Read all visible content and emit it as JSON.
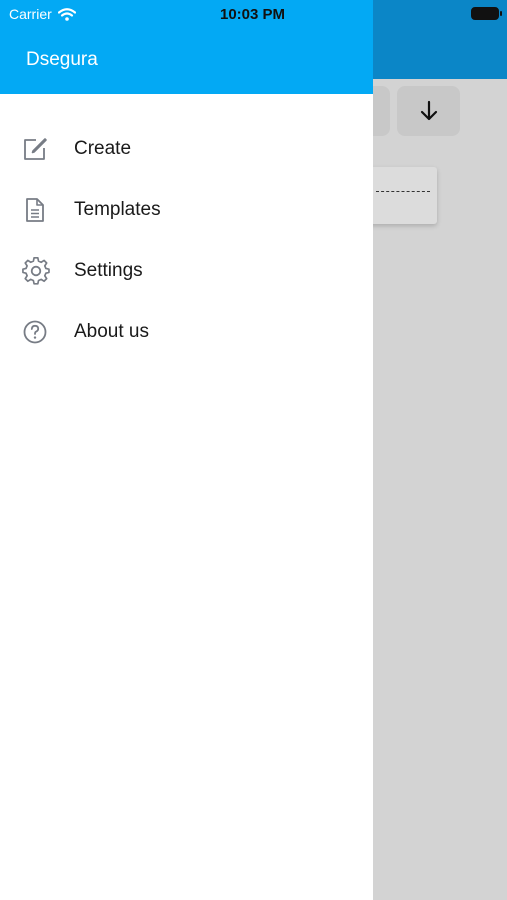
{
  "status_bar": {
    "carrier": "Carrier",
    "time": "10:03 PM"
  },
  "drawer": {
    "username": "Dsegura",
    "header_color": "#03a9f4",
    "items": [
      {
        "label": "Create",
        "icon": "edit-icon"
      },
      {
        "label": "Templates",
        "icon": "document-icon"
      },
      {
        "label": "Settings",
        "icon": "gear-icon"
      },
      {
        "label": "About us",
        "icon": "help-circle-icon"
      }
    ]
  },
  "background_app": {
    "header_color": "#0b86c7",
    "sort_button_icon": "arrow-down-icon"
  }
}
